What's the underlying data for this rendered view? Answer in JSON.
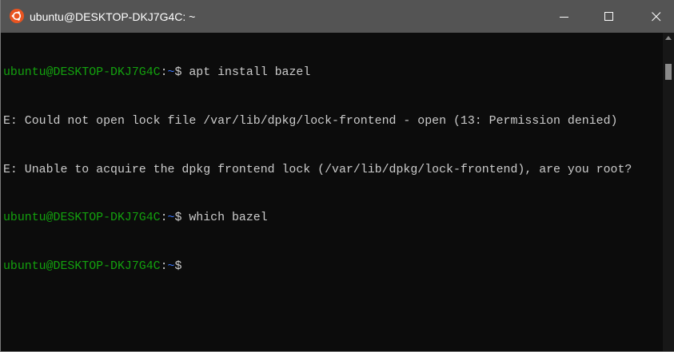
{
  "window": {
    "title": "ubuntu@DESKTOP-DKJ7G4C: ~",
    "app_icon": "ubuntu-logo-icon",
    "controls": {
      "minimize": "minimize-icon",
      "maximize": "maximize-icon",
      "close": "close-icon"
    }
  },
  "terminal": {
    "lines": [
      {
        "type": "prompt",
        "user_host": "ubuntu@DESKTOP-DKJ7G4C",
        "sep": ":",
        "path": "~",
        "dollar": "$ ",
        "command": "apt install bazel"
      },
      {
        "type": "output",
        "text": "E: Could not open lock file /var/lib/dpkg/lock-frontend - open (13: Permission denied)"
      },
      {
        "type": "output",
        "text": "E: Unable to acquire the dpkg frontend lock (/var/lib/dpkg/lock-frontend), are you root?"
      },
      {
        "type": "prompt",
        "user_host": "ubuntu@DESKTOP-DKJ7G4C",
        "sep": ":",
        "path": "~",
        "dollar": "$ ",
        "command": "which bazel"
      },
      {
        "type": "prompt",
        "user_host": "ubuntu@DESKTOP-DKJ7G4C",
        "sep": ":",
        "path": "~",
        "dollar": "$",
        "command": ""
      }
    ]
  },
  "colors": {
    "titlebar": "#545454",
    "background": "#0c0c0c",
    "prompt_user": "#13a10e",
    "prompt_path": "#3b78ff",
    "text": "#cccccc",
    "ubuntu_orange": "#e95420"
  }
}
